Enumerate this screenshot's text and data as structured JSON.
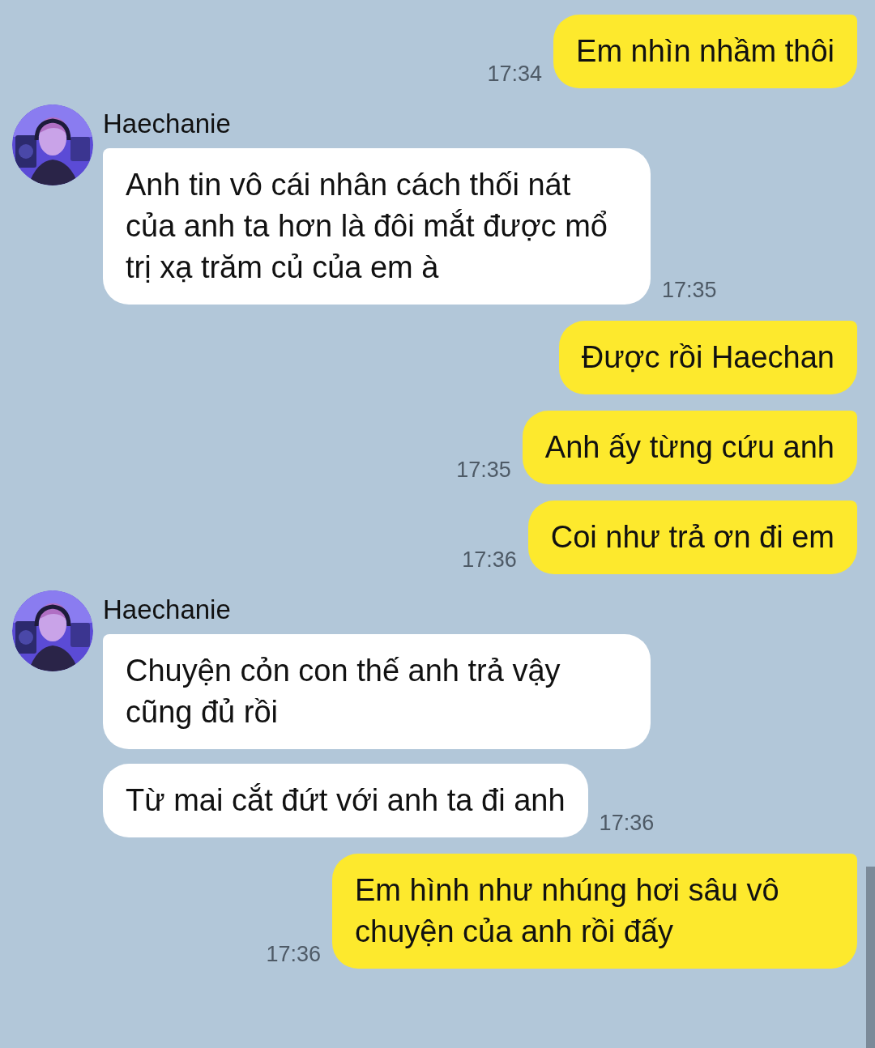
{
  "messages": [
    {
      "kind": "sent",
      "text": "Em nhìn nhầm thôi",
      "time": "17:34"
    },
    {
      "kind": "received",
      "sender": "Haechanie",
      "bubbles": [
        {
          "text": "Anh tin vô cái nhân cách thối nát của anh ta hơn là đôi mắt được mổ trị xạ trăm củ của em à",
          "time": "17:35"
        }
      ]
    },
    {
      "kind": "sent",
      "text": "Được rồi Haechan"
    },
    {
      "kind": "sent",
      "text": "Anh ấy từng cứu anh",
      "time": "17:35"
    },
    {
      "kind": "sent",
      "text": "Coi như trả ơn đi em",
      "time": "17:36"
    },
    {
      "kind": "received",
      "sender": "Haechanie",
      "bubbles": [
        {
          "text": "Chuyện cỏn con thế anh trả vậy cũng đủ rồi"
        },
        {
          "text": "Từ mai cắt đứt với anh ta đi anh",
          "time": "17:36"
        }
      ]
    },
    {
      "kind": "sent",
      "text": "Em hình như nhúng hơi sâu vô chuyện của anh rồi đấy",
      "time": "17:36"
    }
  ]
}
